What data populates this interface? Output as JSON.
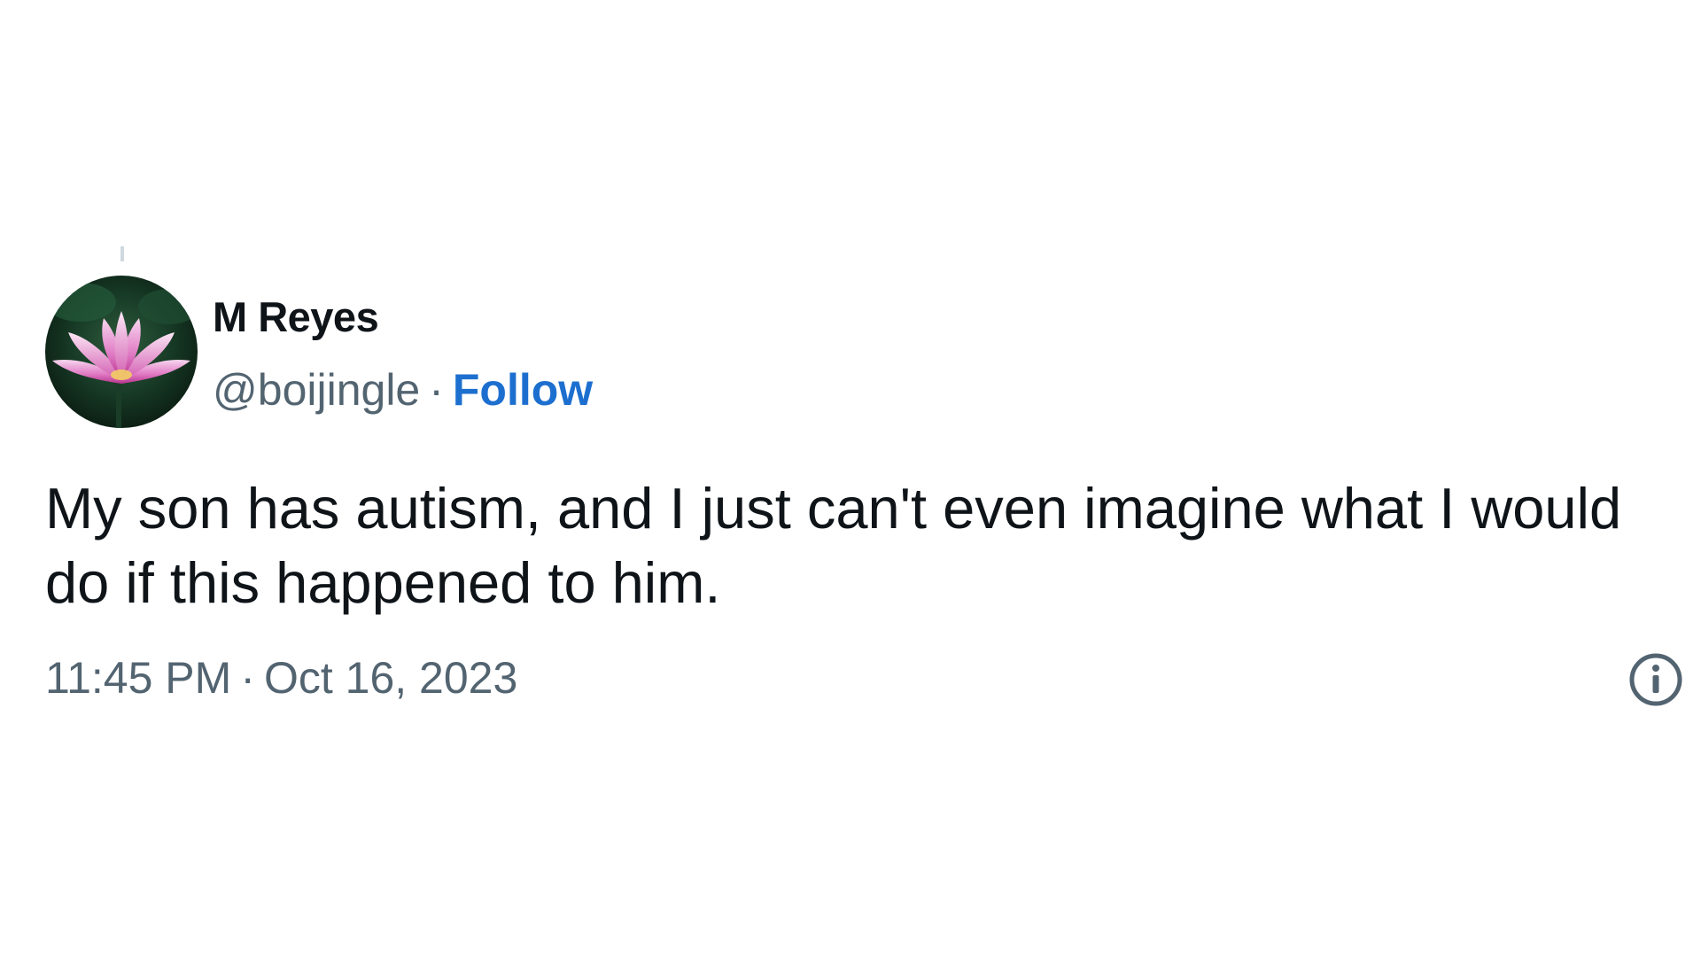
{
  "author": {
    "display_name": "M Reyes",
    "handle": "@boijingle",
    "separator": "·",
    "follow_label": "Follow",
    "avatar": "lotus-flower-avatar"
  },
  "tweet": {
    "text": "My son has autism, and I just can't even imagine what I would do if this happened to him."
  },
  "meta": {
    "time": "11:45 PM",
    "separator": "·",
    "date": "Oct 16, 2023",
    "info_icon": "info-icon"
  },
  "colors": {
    "follow_link": "#1d6fcf",
    "secondary_text": "#536471",
    "primary_text": "#0f1419",
    "thread_line": "#cfd9de"
  }
}
